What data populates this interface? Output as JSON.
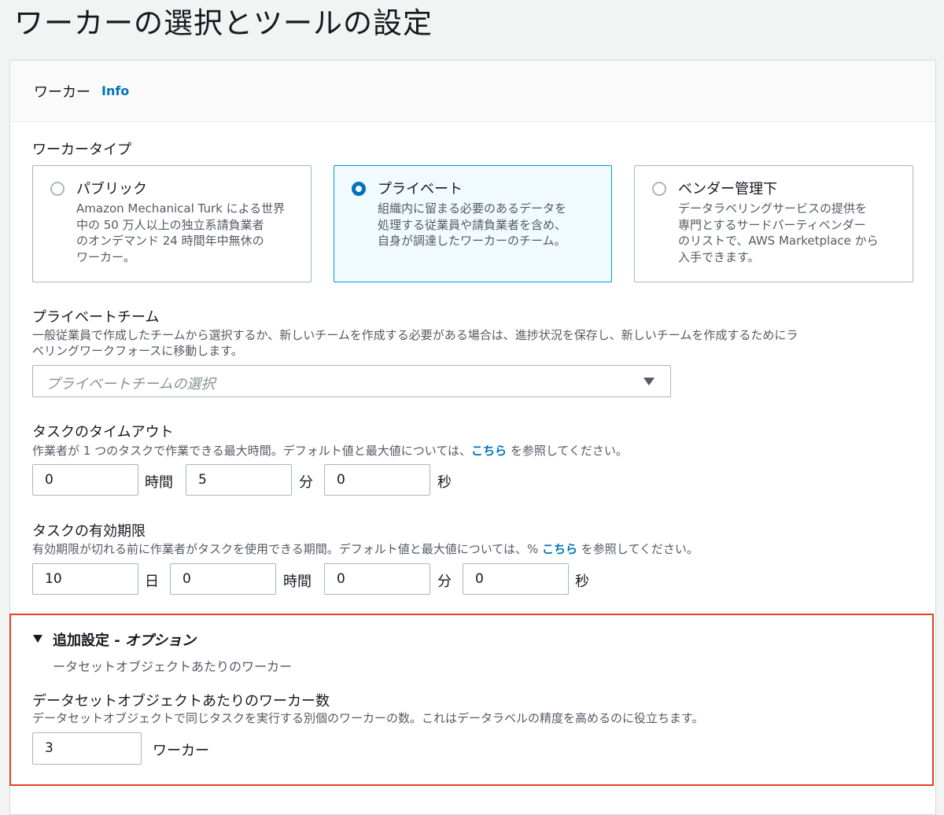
{
  "page": {
    "title": "ワーカーの選択とツールの設定"
  },
  "panel": {
    "title": "ワーカー",
    "info": "Info"
  },
  "worker_type": {
    "label": "ワーカータイプ",
    "options": [
      {
        "title": "パブリック",
        "description": [
          "Amazon Mechanical Turk による世界",
          "中の 50 万人以上の独立系請負業者",
          "のオンデマンド 24 時間年中無休の",
          "ワーカー。"
        ],
        "selected": false
      },
      {
        "title": "プライベート",
        "description": [
          "組織内に留まる必要のあるデータを",
          "処理する従業員や請負業者を含め、",
          "自身が調達したワーカーのチーム。"
        ],
        "selected": true
      },
      {
        "title": "ベンダー管理下",
        "description": [
          "データラベリングサービスの提供を",
          "専門とするサードパーティベンダー",
          "のリストで、AWS Marketplace から",
          "入手できます。"
        ],
        "selected": false
      }
    ]
  },
  "private_team": {
    "label": "プライベートチーム",
    "description": [
      "一般従業員で作成したチームから選択するか、新しいチームを作成する必要がある場合は、進捗状況を保存し、新しいチームを作成するためにラ",
      "ベリングワークフォースに移動します。"
    ],
    "placeholder": "プライベートチームの選択"
  },
  "task_timeout": {
    "label": "タスクのタイムアウト",
    "description_pre": "作業者が 1 つのタスクで作業できる最大時間。デフォルト値と最大値については、",
    "link": "こちら",
    "description_post": " を参照してください。",
    "hours": "0",
    "hours_unit": "時間",
    "minutes": "5",
    "minutes_unit": "分",
    "seconds": "0",
    "seconds_unit": "秒"
  },
  "task_expiration": {
    "label": "タスクの有効期限",
    "description_pre": "有効期限が切れる前に作業者がタスクを使用できる期間。デフォルト値と最大値については、% ",
    "link": "こちら",
    "description_post": " を参照してください。",
    "days": "10",
    "days_unit": "日",
    "hours": "0",
    "hours_unit": "時間",
    "minutes": "0",
    "minutes_unit": "分",
    "seconds": "0",
    "seconds_unit": "秒"
  },
  "additional": {
    "title": "追加設定 - ",
    "title_optional": "オプション",
    "summary": "ータセットオブジェクトあたりのワーカー",
    "workers_label": "データセットオブジェクトあたりのワーカー数",
    "workers_description": "データセットオブジェクトで同じタスクを実行する別個のワーカーの数。これはデータラベルの精度を高めるのに役立ちます。",
    "workers_value": "3",
    "workers_unit": "ワーカー"
  },
  "colors": {
    "accent": "#0073bb",
    "highlight": "#e2412b",
    "selected_bg": "#f1faff"
  }
}
